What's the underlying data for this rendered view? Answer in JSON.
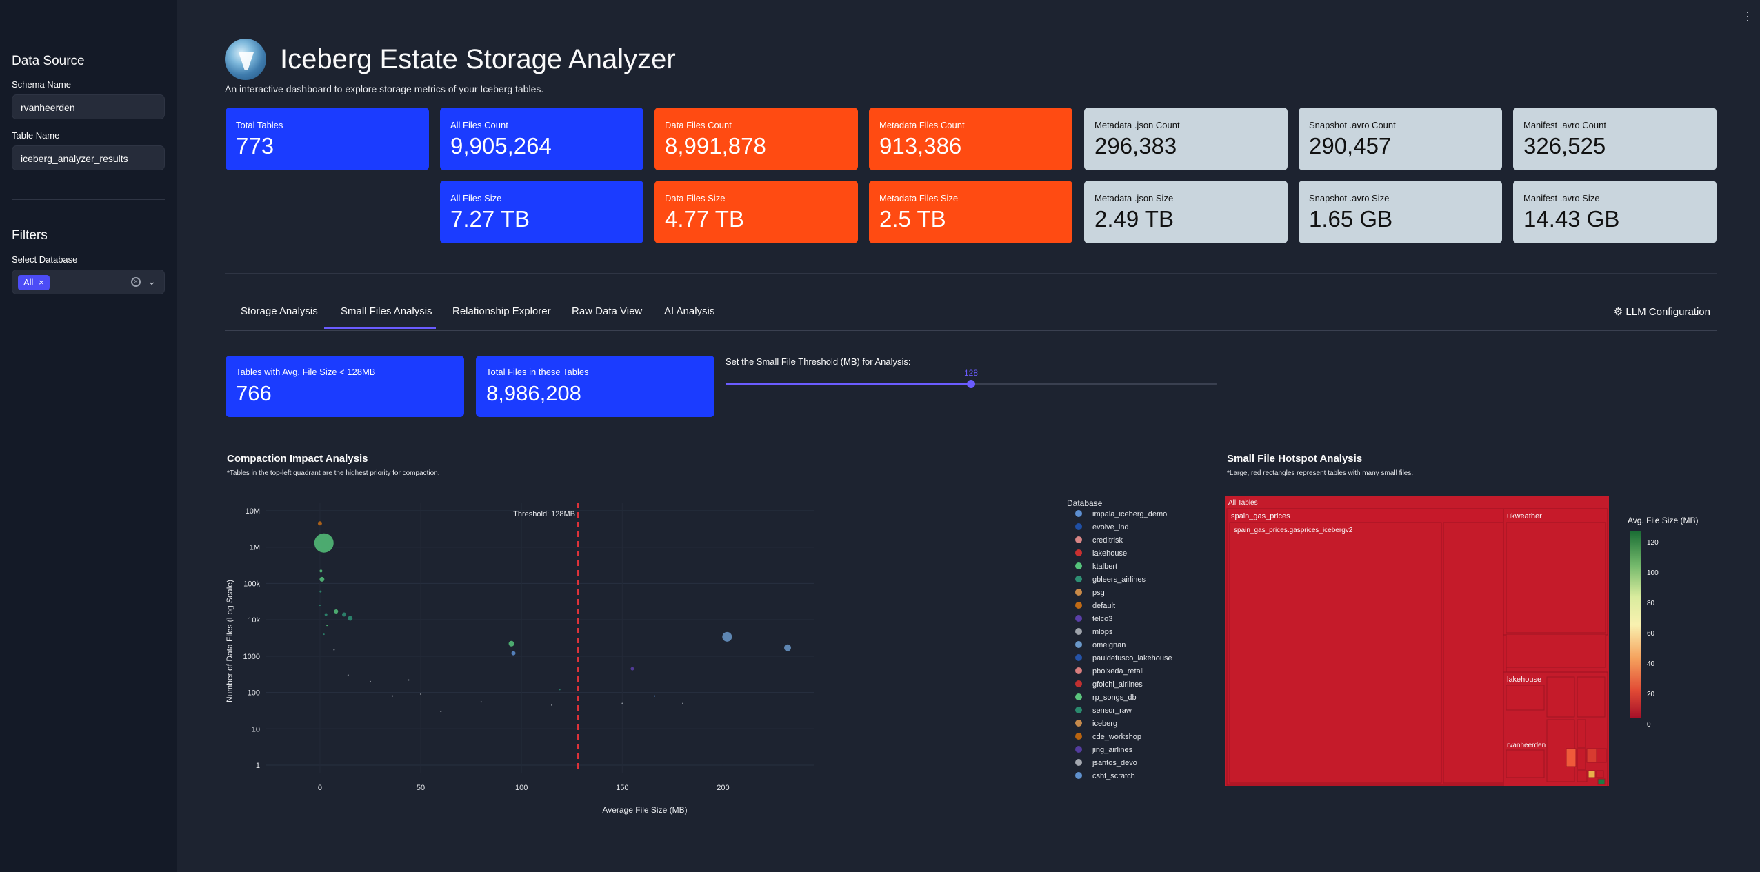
{
  "sidebar": {
    "data_source_heading": "Data Source",
    "schema_label": "Schema Name",
    "schema_value": "rvanheerden",
    "table_label": "Table Name",
    "table_value": "iceberg_analyzer_results",
    "filters_heading": "Filters",
    "db_label": "Select Database",
    "db_chip": "All",
    "chip_close": "×"
  },
  "header": {
    "title": "Iceberg Estate Storage Analyzer",
    "subtitle": "An interactive dashboard to explore storage metrics of your Iceberg tables."
  },
  "metrics": {
    "total_tables": {
      "label": "Total Tables",
      "value": "773"
    },
    "all_files_count": {
      "label": "All Files Count",
      "value": "9,905,264"
    },
    "data_files_count": {
      "label": "Data Files Count",
      "value": "8,991,878"
    },
    "metadata_files_count": {
      "label": "Metadata Files Count",
      "value": "913,386"
    },
    "metadata_json_count": {
      "label": "Metadata .json Count",
      "value": "296,383"
    },
    "snapshot_avro_count": {
      "label": "Snapshot .avro Count",
      "value": "290,457"
    },
    "manifest_avro_count": {
      "label": "Manifest .avro Count",
      "value": "326,525"
    },
    "all_files_size": {
      "label": "All Files Size",
      "value": "7.27 TB"
    },
    "data_files_size": {
      "label": "Data Files Size",
      "value": "4.77 TB"
    },
    "metadata_files_size": {
      "label": "Metadata Files Size",
      "value": "2.5 TB"
    },
    "metadata_json_size": {
      "label": "Metadata .json Size",
      "value": "2.49 TB"
    },
    "snapshot_avro_size": {
      "label": "Snapshot .avro Size",
      "value": "1.65 GB"
    },
    "manifest_avro_size": {
      "label": "Manifest .avro Size",
      "value": "14.43 GB"
    }
  },
  "tabs": [
    "Storage Analysis",
    "Small Files Analysis",
    "Relationship Explorer",
    "Raw Data View",
    "AI Analysis"
  ],
  "active_tab": "Small Files Analysis",
  "llm_config": "LLM Configuration",
  "small_files": {
    "tables_label": "Tables with Avg. File Size < 128MB",
    "tables_value": "766",
    "files_label": "Total Files in these Tables",
    "files_value": "8,986,208",
    "slider_label": "Set the Small File Threshold (MB) for Analysis:",
    "slider_value": "128",
    "slider_min": 0,
    "slider_max": 256
  },
  "compaction": {
    "title": "Compaction Impact Analysis",
    "note": "*Tables in the top-left quadrant are the highest priority for compaction."
  },
  "hotspot": {
    "title": "Small File Hotspot Analysis",
    "note": "*Large, red rectangles represent tables with many small files.",
    "root": "All Tables",
    "nodes": [
      "spain_gas_prices",
      "spain_gas_prices.gasprices_icebergv2",
      "ukweather",
      "lakehouse",
      "rvanheerden"
    ],
    "colorbar_title": "Avg. File Size (MB)",
    "colorbar_ticks": [
      "120",
      "100",
      "80",
      "60",
      "40",
      "20",
      "0"
    ]
  },
  "chart_data": {
    "type": "scatter",
    "title": "",
    "xlabel": "Average File Size (MB)",
    "ylabel": "Number of Data Files (Log Scale)",
    "x_ticks": [
      "0",
      "50",
      "100",
      "150",
      "200"
    ],
    "y_ticks": [
      "10M",
      "1M",
      "100k",
      "10k",
      "1000",
      "100",
      "10",
      "1"
    ],
    "x_range": [
      -27,
      245
    ],
    "y_log_range": [
      0,
      7
    ],
    "threshold": 128,
    "threshold_label": "Threshold: 128MB",
    "legend_title": "Database",
    "series": [
      {
        "name": "impala_iceberg_demo",
        "color": "#5d8fd1"
      },
      {
        "name": "evolve_ind",
        "color": "#1f4fa5"
      },
      {
        "name": "creditrisk",
        "color": "#d88585"
      },
      {
        "name": "lakehouse",
        "color": "#c93030"
      },
      {
        "name": "ktalbert",
        "color": "#55c27a"
      },
      {
        "name": "gbleers_airlines",
        "color": "#2e8f73"
      },
      {
        "name": "psg",
        "color": "#c98a48"
      },
      {
        "name": "default",
        "color": "#c06a15"
      },
      {
        "name": "telco3",
        "color": "#5a3fa8"
      },
      {
        "name": "mlops",
        "color": "#9ea3ab"
      },
      {
        "name": "omeignan",
        "color": "#6a98c9"
      },
      {
        "name": "pauldefusco_lakehouse",
        "color": "#2553a8"
      },
      {
        "name": "pboixeda_retail",
        "color": "#d87d7d"
      },
      {
        "name": "gfolchi_airlines",
        "color": "#c03030"
      },
      {
        "name": "rp_songs_db",
        "color": "#5bc47c"
      },
      {
        "name": "sensor_raw",
        "color": "#2a8a6e"
      },
      {
        "name": "iceberg",
        "color": "#c58a4c"
      },
      {
        "name": "cde_workshop",
        "color": "#b8630f"
      },
      {
        "name": "jing_airlines",
        "color": "#533c9e"
      },
      {
        "name": "jsantos_devo",
        "color": "#a4a8b0"
      },
      {
        "name": "csht_scratch",
        "color": "#5f90cc"
      }
    ],
    "points": [
      {
        "x": 2,
        "y": 1300000,
        "r": 14,
        "c": "#55c27a"
      },
      {
        "x": 0,
        "y": 4500000,
        "r": 3,
        "c": "#c06a15"
      },
      {
        "x": 0.5,
        "y": 220000,
        "r": 2,
        "c": "#55c27a"
      },
      {
        "x": 1,
        "y": 130000,
        "r": 3.5,
        "c": "#55c27a"
      },
      {
        "x": 0.3,
        "y": 60000,
        "r": 1.5,
        "c": "#2e8f73"
      },
      {
        "x": 3,
        "y": 14000,
        "r": 2,
        "c": "#2e8f73"
      },
      {
        "x": 0,
        "y": 25000,
        "r": 1,
        "c": "#2e8f73"
      },
      {
        "x": 8,
        "y": 17000,
        "r": 3,
        "c": "#55c27a"
      },
      {
        "x": 12,
        "y": 14000,
        "r": 3,
        "c": "#2e8f73"
      },
      {
        "x": 15,
        "y": 11000,
        "r": 3.5,
        "c": "#2e8f73"
      },
      {
        "x": 3.5,
        "y": 7000,
        "r": 1,
        "c": "#55c27a"
      },
      {
        "x": 2,
        "y": 4000,
        "r": 1,
        "c": "#2e8f73"
      },
      {
        "x": 7,
        "y": 1500,
        "r": 1,
        "c": "#9ea3ab"
      },
      {
        "x": 14,
        "y": 300,
        "r": 1,
        "c": "#9ea3ab"
      },
      {
        "x": 25,
        "y": 200,
        "r": 1,
        "c": "#9ea3ab"
      },
      {
        "x": 95,
        "y": 2200,
        "r": 4,
        "c": "#55c27a"
      },
      {
        "x": 96,
        "y": 1200,
        "r": 3,
        "c": "#5d8fd1"
      },
      {
        "x": 119,
        "y": 120,
        "r": 1,
        "c": "#2e8f73"
      },
      {
        "x": 155,
        "y": 450,
        "r": 2.5,
        "c": "#5a3fa8"
      },
      {
        "x": 166,
        "y": 80,
        "r": 1,
        "c": "#5d8fd1"
      },
      {
        "x": 202,
        "y": 3400,
        "r": 7,
        "c": "#6a98c9"
      },
      {
        "x": 232,
        "y": 1700,
        "r": 5,
        "c": "#6a98c9"
      },
      {
        "x": 36,
        "y": 80,
        "r": 1,
        "c": "#9ea3ab"
      },
      {
        "x": 44,
        "y": 220,
        "r": 1,
        "c": "#9ea3ab"
      },
      {
        "x": 80,
        "y": 55,
        "r": 1,
        "c": "#9ea3ab"
      },
      {
        "x": 115,
        "y": 45,
        "r": 1,
        "c": "#9ea3ab"
      },
      {
        "x": 150,
        "y": 50,
        "r": 1,
        "c": "#9ea3ab"
      },
      {
        "x": 180,
        "y": 50,
        "r": 1,
        "c": "#9ea3ab"
      },
      {
        "x": 50,
        "y": 90,
        "r": 1,
        "c": "#9ea3ab"
      },
      {
        "x": 60,
        "y": 30,
        "r": 1,
        "c": "#9ea3ab"
      }
    ]
  }
}
